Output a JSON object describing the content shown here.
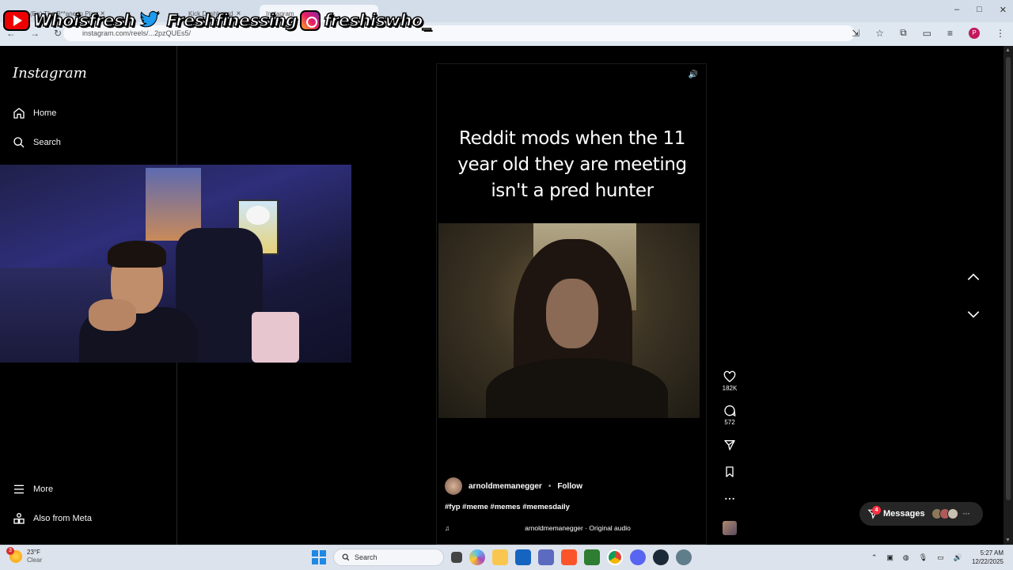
{
  "browser": {
    "tabs": [
      {
        "label": "(Ep) The B**ane to Play"
      },
      {
        "label": "Kick Dashboard"
      },
      {
        "label": "Instagram"
      }
    ],
    "url": "instagram.com/reels/...2pzQUEs5/",
    "profile_initial": "P",
    "window_controls": [
      "–",
      "□",
      "✕"
    ]
  },
  "overlay": {
    "youtube": "Whoisfresh",
    "twitter": "Freshfinessing",
    "instagram": "freshiswho_"
  },
  "sidebar": {
    "logo": "Instagram",
    "items": [
      {
        "label": "Home",
        "icon": "home-icon"
      },
      {
        "label": "Search",
        "icon": "search-icon"
      },
      {
        "label": "More",
        "icon": "menu-icon"
      },
      {
        "label": "Also from Meta",
        "icon": "meta-icon"
      }
    ]
  },
  "reel": {
    "caption_text": "Reddit mods when the 11 year old they are meeting isn't a pred hunter",
    "username": "arnoldmemanegger",
    "separator": "•",
    "follow_label": "Follow",
    "hashtags": "#fyp #meme #memes #memesdaily",
    "audio": "arnoldmemanegger · Original audio"
  },
  "actions": {
    "likes": "182K",
    "comments": "572"
  },
  "messages": {
    "label": "Messages",
    "badge": "4"
  },
  "taskbar": {
    "weather_temp": "23°F",
    "weather_desc": "Clear",
    "weather_badge": "3",
    "search_placeholder": "Search",
    "time": "5:27 AM",
    "date": "12/22/2025"
  }
}
